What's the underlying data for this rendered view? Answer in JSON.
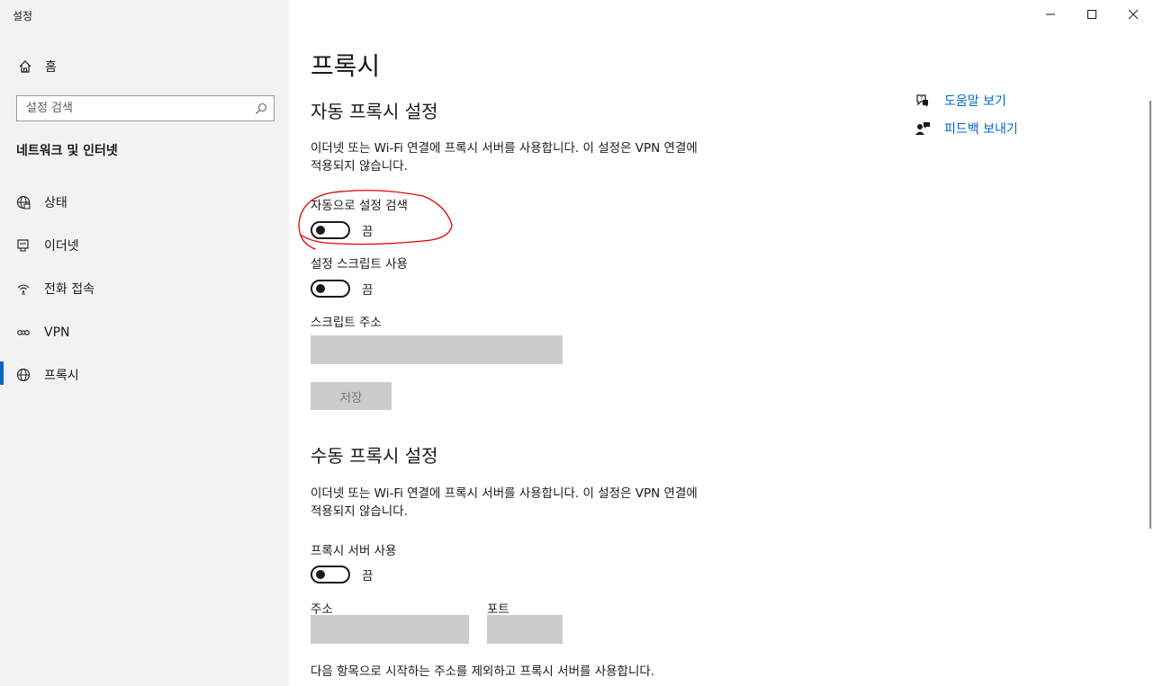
{
  "window": {
    "app_title": "설정"
  },
  "sidebar": {
    "home_label": "홈",
    "search_placeholder": "설정 검색",
    "section_title": "네트워크 및 인터넷",
    "items": [
      {
        "label": "상태",
        "icon": "globe-status-icon"
      },
      {
        "label": "이더넷",
        "icon": "ethernet-icon"
      },
      {
        "label": "전화 접속",
        "icon": "dial-up-icon"
      },
      {
        "label": "VPN",
        "icon": "vpn-icon"
      },
      {
        "label": "프록시",
        "icon": "globe-icon",
        "active": true
      }
    ]
  },
  "main": {
    "title": "프록시",
    "auto": {
      "heading": "자동 프록시 설정",
      "description": "이더넷 또는 Wi-Fi 연결에 프록시 서버를 사용합니다. 이 설정은 VPN 연결에 적용되지 않습니다.",
      "detect_label": "자동으로 설정 검색",
      "detect_state": "끔",
      "script_label": "설정 스크립트 사용",
      "script_state": "끔",
      "address_label": "스크립트 주소",
      "save_label": "저장"
    },
    "manual": {
      "heading": "수동 프록시 설정",
      "description": "이더넷 또는 Wi-Fi 연결에 프록시 서버를 사용합니다. 이 설정은 VPN 연결에 적용되지 않습니다.",
      "proxy_label": "프록시 서버 사용",
      "proxy_state": "끔",
      "address_label": "주소",
      "port_label": "포트",
      "exclusion_text": "다음 항목으로 시작하는 주소를 제외하고 프록시 서버를 사용합니다."
    },
    "links": {
      "help": "도움말 보기",
      "feedback": "피드백 보내기"
    }
  },
  "colors": {
    "accent": "#0067c0",
    "annotation": "#e00000",
    "sidebar_bg": "#f2f2f2",
    "disabled": "#cccccc"
  }
}
